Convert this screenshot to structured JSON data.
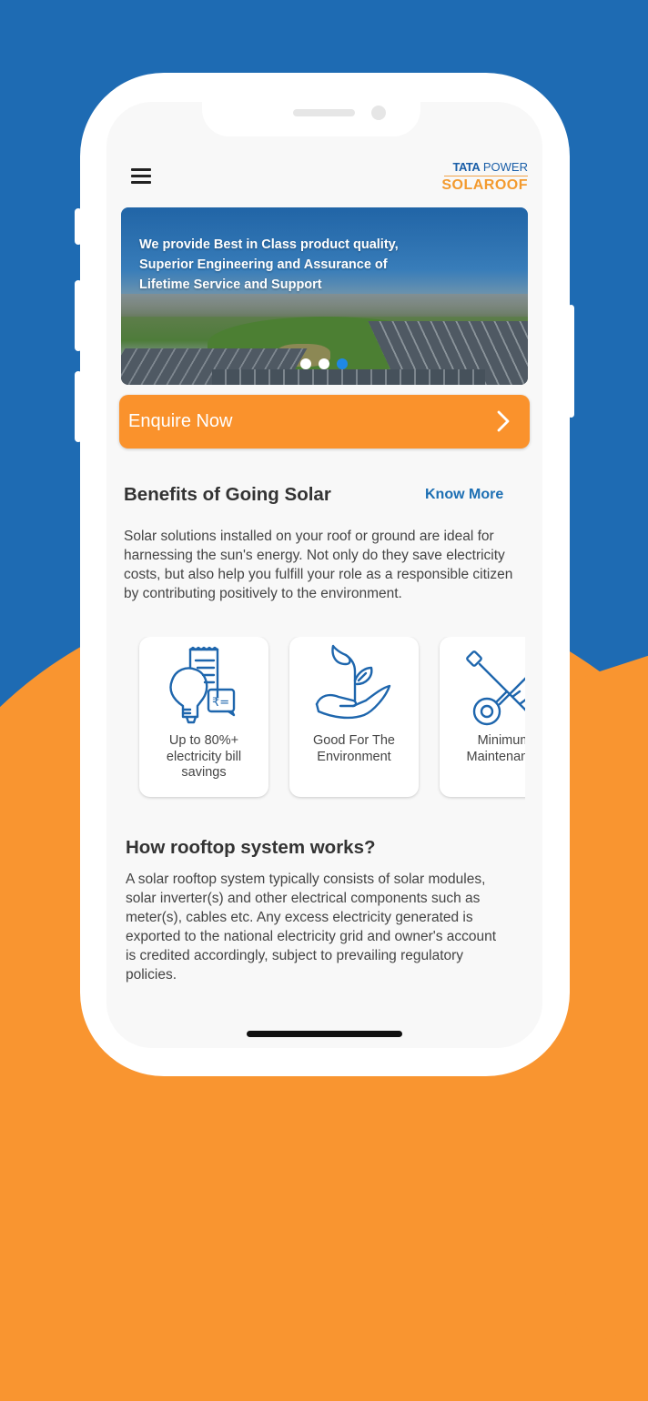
{
  "header": {
    "menu_icon": "hamburger-menu-icon",
    "logo": {
      "line1_bold": "TATA",
      "line1_rest": "POWER",
      "line2": "SOLAROOF"
    }
  },
  "banner": {
    "text": "We provide Best in Class product quality, Superior Engineering and Assurance of Lifetime Service and Support",
    "slides": 3,
    "active_slide": 3
  },
  "enquire": {
    "label": "Enquire Now",
    "icon": "chevron-right-icon"
  },
  "benefits": {
    "title": "Benefits of Going Solar",
    "know_more": "Know More",
    "description": "Solar solutions installed on your roof or ground are ideal for harnessing the sun's energy. Not only do they save electricity costs, but also help you fulfill your role as a responsible citizen by contributing positively to the environment.",
    "cards": [
      {
        "icon": "bulb-bill-icon",
        "label": "Up to 80%+ electricity bill savings"
      },
      {
        "icon": "plant-hand-icon",
        "label": "Good For The Environment"
      },
      {
        "icon": "tools-icon",
        "label": "Minimum Maintenance"
      }
    ]
  },
  "how_it_works": {
    "title": "How rooftop system works?",
    "description": "A solar rooftop system typically consists of solar modules, solar inverter(s) and other electrical components such as meter(s), cables etc. Any excess electricity generated is exported to the national electricity grid and owner's account is credited accordingly, subject to prevailing regulatory policies."
  },
  "colors": {
    "brand_blue": "#1e6bb3",
    "brand_orange": "#f99530",
    "link_blue": "#1d6fb3",
    "active_dot": "#1e88e5"
  }
}
